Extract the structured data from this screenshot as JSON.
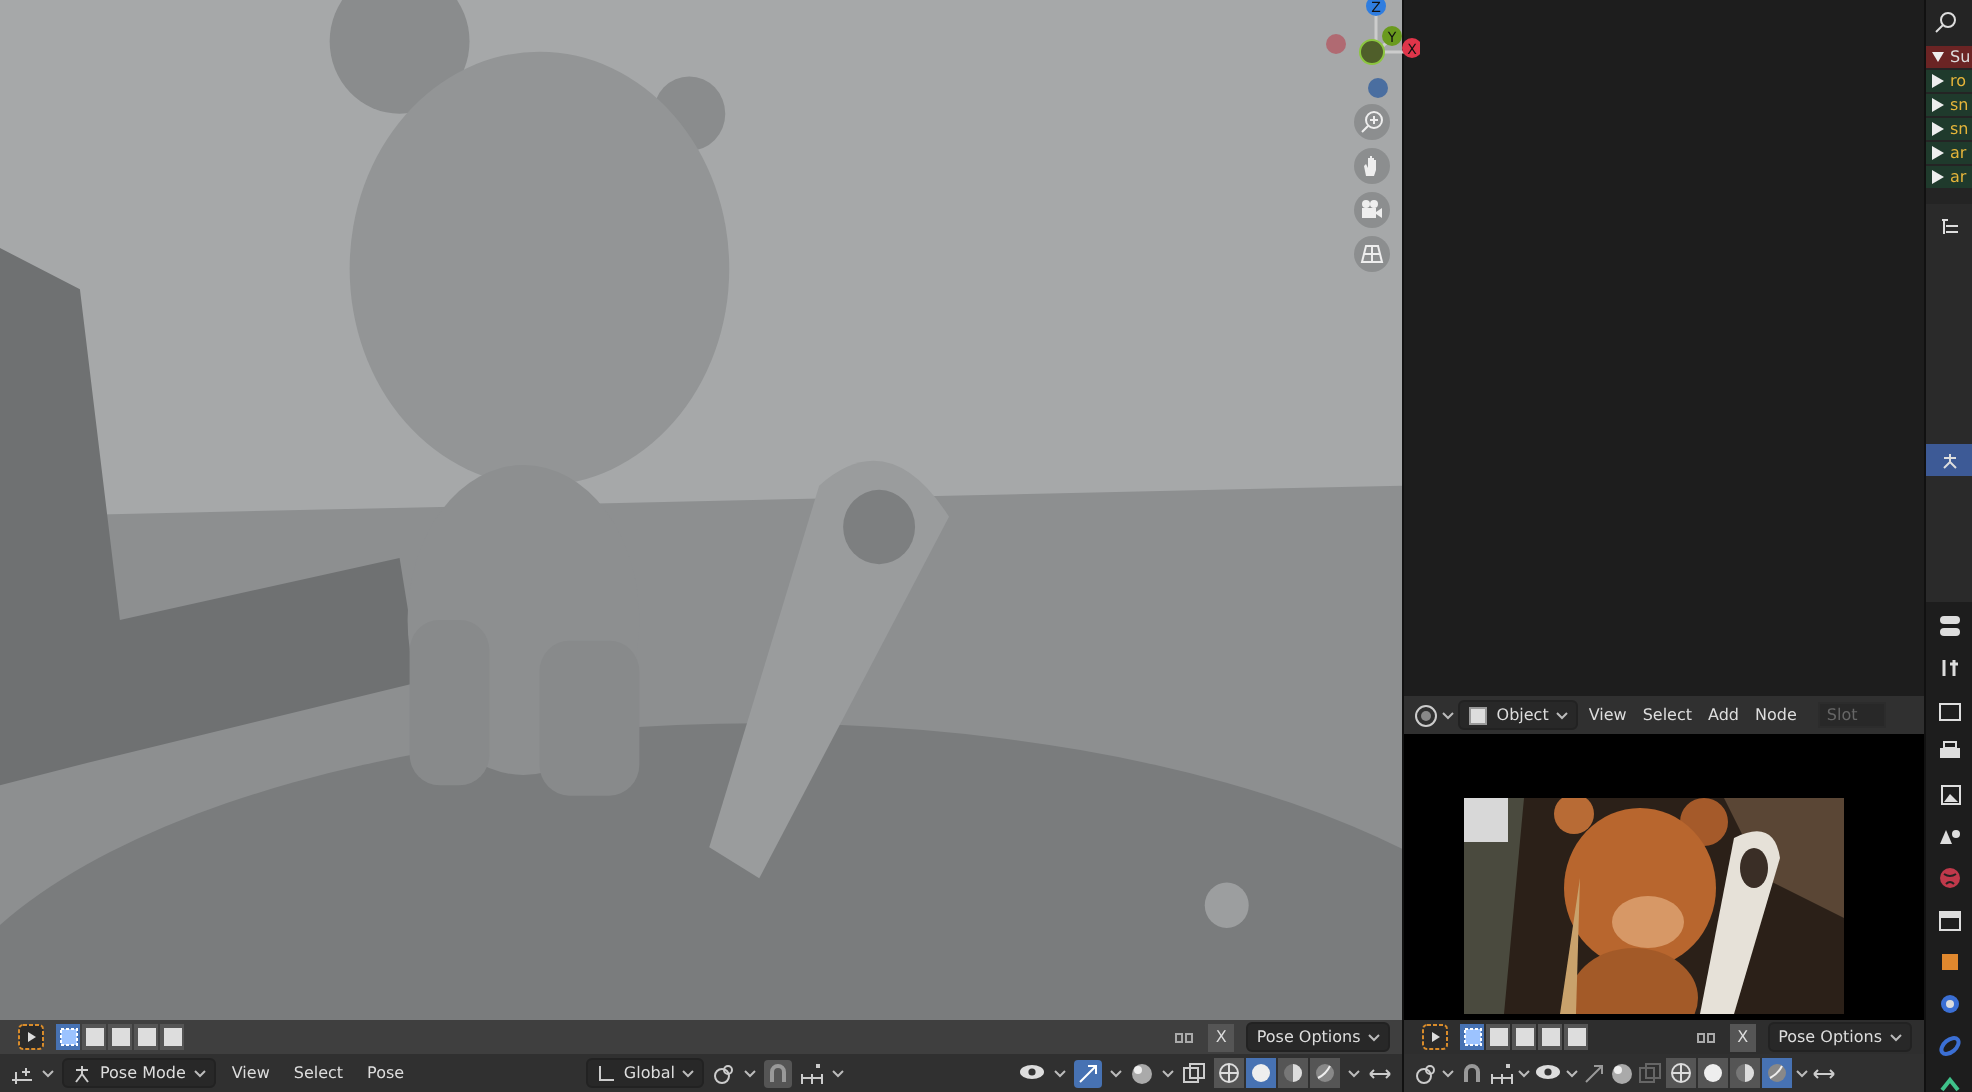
{
  "viewport": {
    "gizmo_axes": [
      "Z",
      "Y",
      "X"
    ],
    "tool_header": {
      "select_modes": [
        {
          "selected": true
        },
        {
          "selected": false
        },
        {
          "selected": false
        },
        {
          "selected": false
        },
        {
          "selected": false
        }
      ],
      "close": "X",
      "options": "Pose Options"
    },
    "header": {
      "mode": "Pose Mode",
      "menus": [
        "View",
        "Select",
        "Pose"
      ],
      "orientation": "Global",
      "shading": [
        {
          "selected": false
        },
        {
          "selected": true
        },
        {
          "selected": false
        },
        {
          "selected": false
        }
      ]
    }
  },
  "shader_editor": {
    "header": {
      "object": "Object",
      "menus": [
        "View",
        "Select",
        "Add",
        "Node"
      ],
      "slot_placeholder": "Slot"
    }
  },
  "preview": {
    "tool_header": {
      "select_modes": [
        {
          "selected": true
        },
        {
          "selected": false
        },
        {
          "selected": false
        },
        {
          "selected": false
        },
        {
          "selected": false
        }
      ],
      "close": "X",
      "options": "Pose Options"
    },
    "header": {
      "shading": [
        {
          "selected": false
        },
        {
          "selected": false
        },
        {
          "selected": false
        },
        {
          "selected": true
        }
      ]
    }
  },
  "outliner": {
    "items": [
      {
        "label": "Su",
        "kind": "collection"
      },
      {
        "label": "ro",
        "kind": "object"
      },
      {
        "label": "sn",
        "kind": "object"
      },
      {
        "label": "sn",
        "kind": "object"
      },
      {
        "label": "ar",
        "kind": "object"
      },
      {
        "label": "ar",
        "kind": "object"
      }
    ],
    "side_tabs": [
      {
        "selected": false
      },
      {
        "selected": true
      }
    ]
  }
}
